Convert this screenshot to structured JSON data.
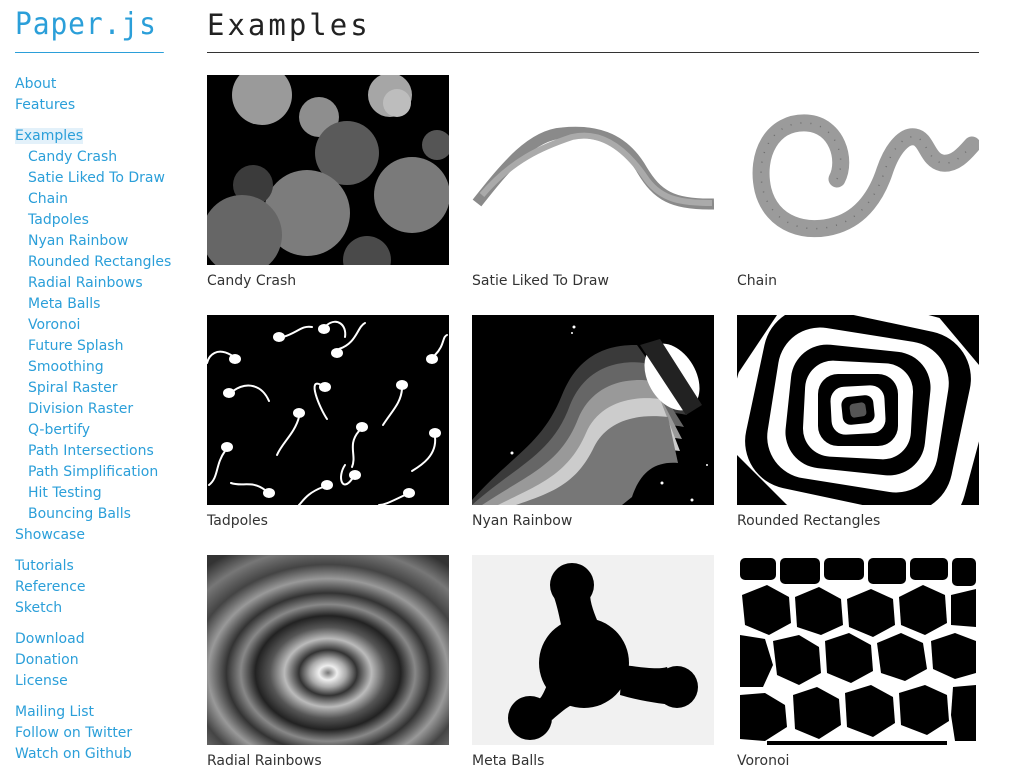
{
  "sidebar": {
    "logo": "Paper.js",
    "groups": [
      [
        {
          "label": "About"
        },
        {
          "label": "Features"
        }
      ],
      [
        {
          "label": "Examples",
          "active": true
        },
        {
          "label": "Candy Crash",
          "sub": true
        },
        {
          "label": "Satie Liked To Draw",
          "sub": true
        },
        {
          "label": "Chain",
          "sub": true
        },
        {
          "label": "Tadpoles",
          "sub": true
        },
        {
          "label": "Nyan Rainbow",
          "sub": true
        },
        {
          "label": "Rounded Rectangles",
          "sub": true
        },
        {
          "label": "Radial Rainbows",
          "sub": true
        },
        {
          "label": "Meta Balls",
          "sub": true
        },
        {
          "label": "Voronoi",
          "sub": true
        },
        {
          "label": "Future Splash",
          "sub": true
        },
        {
          "label": "Smoothing",
          "sub": true
        },
        {
          "label": "Spiral Raster",
          "sub": true
        },
        {
          "label": "Division Raster",
          "sub": true
        },
        {
          "label": "Q-bertify",
          "sub": true
        },
        {
          "label": "Path Intersections",
          "sub": true
        },
        {
          "label": "Path Simplification",
          "sub": true
        },
        {
          "label": "Hit Testing",
          "sub": true
        },
        {
          "label": "Bouncing Balls",
          "sub": true
        },
        {
          "label": "Showcase"
        }
      ],
      [
        {
          "label": "Tutorials"
        },
        {
          "label": "Reference"
        },
        {
          "label": "Sketch"
        }
      ],
      [
        {
          "label": "Download"
        },
        {
          "label": "Donation"
        },
        {
          "label": "License"
        }
      ],
      [
        {
          "label": "Mailing List"
        },
        {
          "label": "Follow on Twitter"
        },
        {
          "label": "Watch on Github"
        }
      ]
    ]
  },
  "main": {
    "title": "Examples",
    "examples": [
      {
        "id": "candy-crash",
        "label": "Candy Crash"
      },
      {
        "id": "satie",
        "label": "Satie Liked To Draw"
      },
      {
        "id": "chain",
        "label": "Chain"
      },
      {
        "id": "tadpoles",
        "label": "Tadpoles"
      },
      {
        "id": "nyan-rainbow",
        "label": "Nyan Rainbow"
      },
      {
        "id": "rounded-rectangles",
        "label": "Rounded Rectangles"
      },
      {
        "id": "radial-rainbows",
        "label": "Radial Rainbows"
      },
      {
        "id": "meta-balls",
        "label": "Meta Balls"
      },
      {
        "id": "voronoi",
        "label": "Voronoi"
      }
    ]
  },
  "colors": {
    "accent": "#2b9fd9",
    "active_bg": "#e3f1fa"
  }
}
